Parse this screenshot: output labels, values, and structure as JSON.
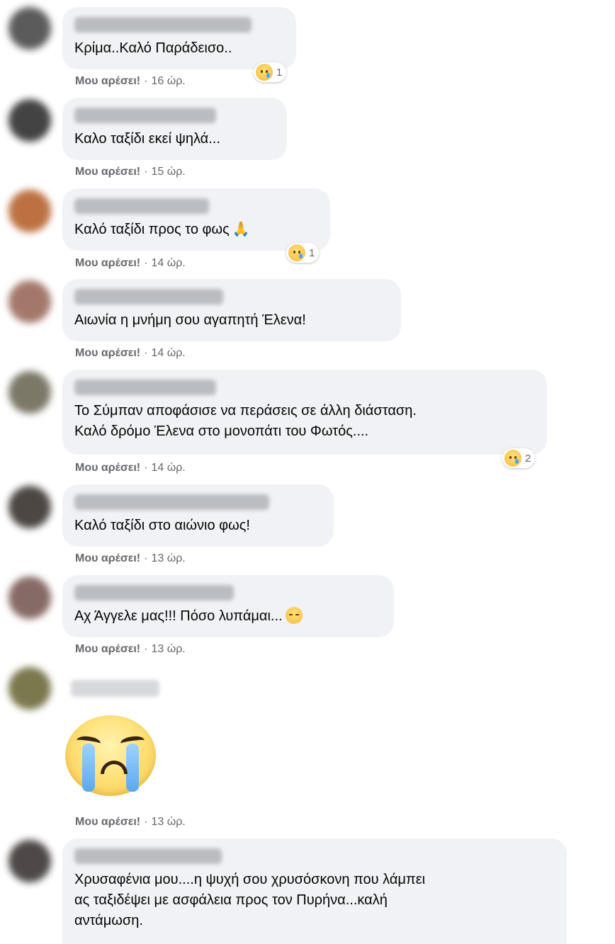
{
  "comments": [
    {
      "text": "Κρίμα..Καλό Παράδεισο..",
      "like": "Μου αρέσει!",
      "time": "16 ώρ.",
      "reaction_count": "1"
    },
    {
      "text": "Καλο ταξίδι εκεί ψηλά...",
      "like": "Μου αρέσει!",
      "time": "15 ώρ."
    },
    {
      "text": "Καλό ταξίδι προς το φως",
      "like": "Μου αρέσει!",
      "time": "14 ώρ.",
      "reaction_count": "1",
      "emoji": "🙏"
    },
    {
      "text": "Αιωνία η μνήμη σου αγαπητή Έλενα!",
      "like": "Μου αρέσει!",
      "time": "14 ώρ."
    },
    {
      "text": "Το Σύμπαν αποφάσισε να περάσεις σε άλλη διάσταση.\nΚαλό δρόμο Έλενα στο μονοπάτι του Φωτός....",
      "like": "Μου αρέσει!",
      "time": "14 ώρ.",
      "reaction_count": "2"
    },
    {
      "text": "Καλό ταξίδι στο αιώνιο φως!",
      "like": "Μου αρέσει!",
      "time": "13 ώρ."
    },
    {
      "text": "Αχ Άγγελε μας!!! Πόσο λυπάμαι...",
      "like": "Μου αρέσει!",
      "time": "13 ώρ."
    },
    {
      "like": "Μου αρέσει!",
      "time": "13 ώρ.",
      "sticker": "crying-face"
    },
    {
      "text": "Χρυσαφένια μου....η ψυχή σου χρυσόσκονη που λάμπει\nας ταξιδέψει με ασφάλεια προς τον Πυρήνα...καλή\nαντάμωση."
    }
  ],
  "colors": {
    "bubble": "#f0f2f5",
    "meta": "#65676b",
    "text": "#050505"
  },
  "separator": "·"
}
